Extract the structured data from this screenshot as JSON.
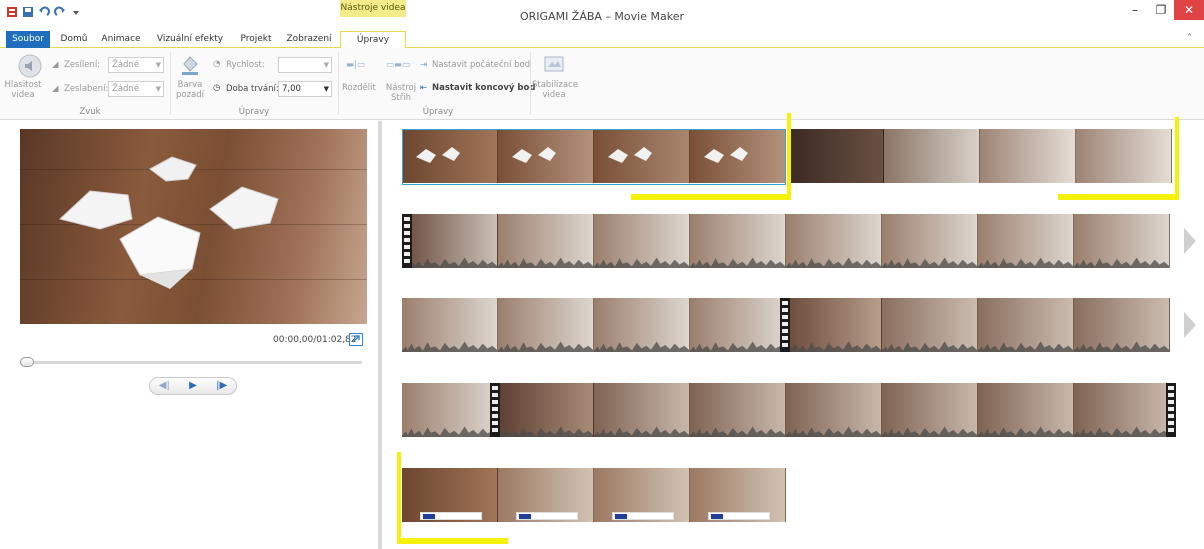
{
  "app": {
    "window_title": "ORIGAMI ŽÁBA – Movie Maker",
    "context_tab_group": "Nástroje videa",
    "window_buttons": [
      "–",
      "❐",
      "✕"
    ],
    "collapse_glyph": "˄"
  },
  "tabs": [
    "Soubor",
    "Domů",
    "Animace",
    "Vizuální efekty",
    "Projekt",
    "Zobrazení",
    "Úpravy"
  ],
  "ribbon": {
    "volume_label_1": "Hlasitost",
    "volume_label_2": "videa",
    "fade_in_label": "Zesílení:",
    "fade_in_value": "Žádné",
    "fade_out_label": "Zeslabení:",
    "fade_out_value": "Žádné",
    "audio_group": "Zvuk",
    "bg_color_1": "Barva",
    "bg_color_2": "pozadí",
    "speed_label": "Rychlost:",
    "speed_value": "",
    "duration_label": "Doba trvání:",
    "duration_value": "7,00",
    "split_label": "Rozdělit",
    "trim_tool_1": "Nástroj",
    "trim_tool_2": "Střih",
    "set_start": "Nastavit počáteční bod",
    "set_end": "Nastavit koncový bod",
    "stabilize_1": "Stabilizace",
    "stabilize_2": "videa",
    "edit_group_1": "Úpravy",
    "edit_group_2": "Úpravy"
  },
  "preview": {
    "timecode": "00:00,00/01:02,82",
    "seek_fraction": 0.0
  },
  "colors": {
    "accent": "#1f6fbd",
    "context_tab": "#f4ec8a",
    "highlight": "#f5f10a",
    "selection": "#33a3d8"
  }
}
